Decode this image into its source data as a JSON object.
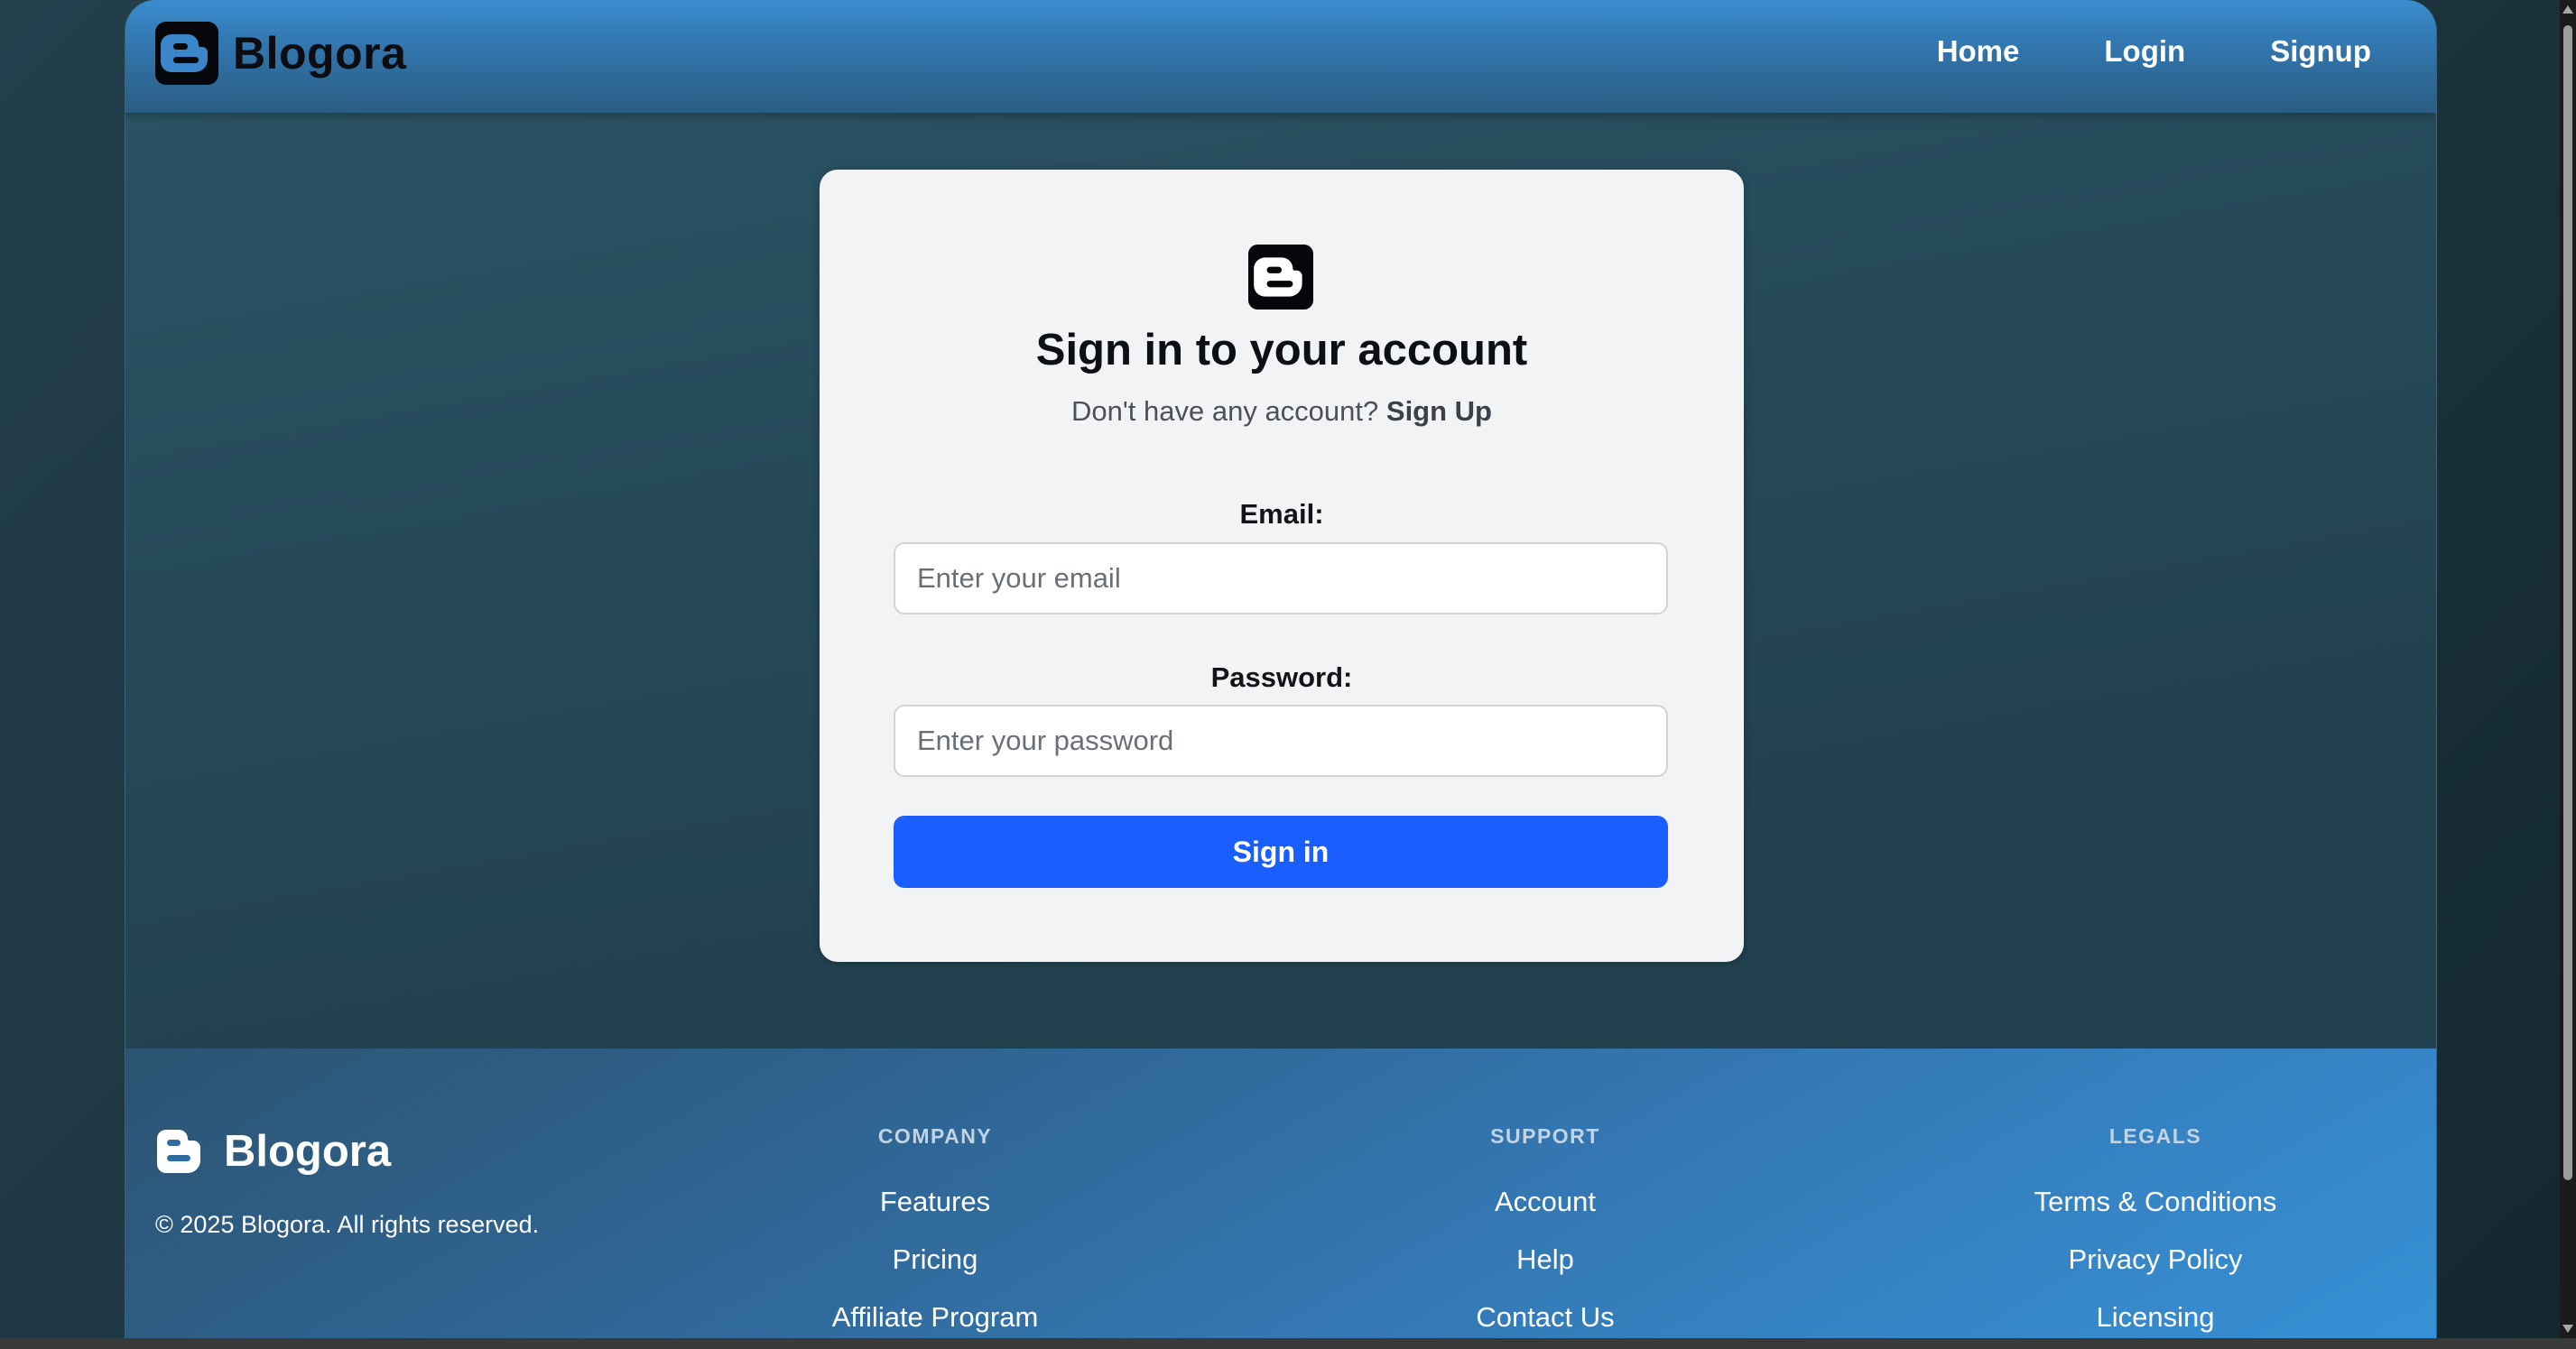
{
  "header": {
    "brand": "Blogora",
    "nav": [
      "Home",
      "Login",
      "Signup"
    ]
  },
  "login": {
    "title": "Sign in to your account",
    "subtitle_prefix": "Don't have any account?",
    "subtitle_link": "Sign Up",
    "email_label": "Email:",
    "email_placeholder": "Enter your email",
    "email_value": "",
    "password_label": "Password:",
    "password_placeholder": "Enter your password",
    "password_value": "",
    "submit_label": "Sign in"
  },
  "footer": {
    "brand": "Blogora",
    "copyright": "© 2025 Blogora. All rights reserved.",
    "columns": [
      {
        "heading": "COMPANY",
        "links": [
          "Features",
          "Pricing",
          "Affiliate Program"
        ]
      },
      {
        "heading": "SUPPORT",
        "links": [
          "Account",
          "Help",
          "Contact Us"
        ]
      },
      {
        "heading": "LEGALS",
        "links": [
          "Terms & Conditions",
          "Privacy Policy",
          "Licensing"
        ]
      }
    ]
  },
  "icons": {
    "brand_logo": "blogger-icon",
    "card_logo": "blogger-icon",
    "footer_logo": "blogger-icon"
  },
  "colors": {
    "primary_button": "#1a5eff",
    "header_top": "#3a8ccf",
    "card_background": "#f2f3f5"
  }
}
